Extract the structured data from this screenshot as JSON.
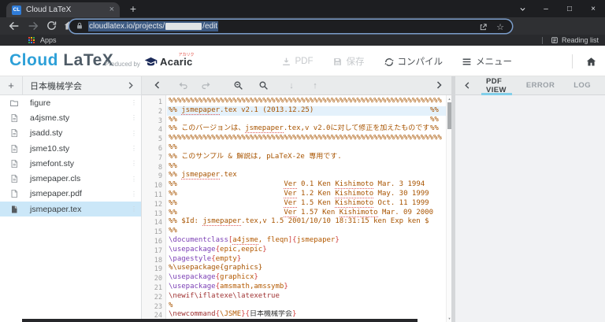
{
  "glyphs": {
    "close_tab": "×",
    "new_tab": "+",
    "overflow": "⋮",
    "star": "☆",
    "minimize": "–",
    "maximize": "□",
    "window_close": "×",
    "arrow_down": "↓",
    "arrow_up": "↑",
    "scroll_up": "▲",
    "scroll_down": "▼",
    "plus": "+"
  },
  "browser": {
    "tab_title": "Cloud LaTeX",
    "favicon_text": "CL",
    "url_prefix": "cloudlatex.io/projects/",
    "url_suffix": "/edit",
    "apps_label": "Apps",
    "reading_list_label": "Reading list"
  },
  "header": {
    "brand_cloud": "Cloud",
    "brand_latex": " LaTeX",
    "produced_by": "Produced by",
    "acaric": "Acaric",
    "acaric_kana": "アカリク",
    "actions": [
      {
        "id": "pdf",
        "label": "PDF",
        "icon": "download-icon",
        "enabled": false
      },
      {
        "id": "save",
        "label": "保存",
        "icon": "save-icon",
        "enabled": false
      },
      {
        "id": "compile",
        "label": "コンパイル",
        "icon": "compile-icon",
        "enabled": true
      },
      {
        "id": "menu",
        "label": "メニュー",
        "icon": "menu-icon",
        "enabled": true
      }
    ]
  },
  "sidebar": {
    "project_name": "日本機械学会",
    "files": [
      {
        "name": "figure",
        "icon": "folder",
        "selected": false
      },
      {
        "name": "a4jsme.sty",
        "icon": "doc",
        "selected": false
      },
      {
        "name": "jsadd.sty",
        "icon": "doc",
        "selected": false
      },
      {
        "name": "jsme10.sty",
        "icon": "doc",
        "selected": false
      },
      {
        "name": "jsmefont.sty",
        "icon": "doc",
        "selected": false
      },
      {
        "name": "jsmepaper.cls",
        "icon": "doc",
        "selected": false
      },
      {
        "name": "jsmepaper.pdf",
        "icon": "page",
        "selected": false
      },
      {
        "name": "jsmepaper.tex",
        "icon": "doc-filled",
        "selected": true
      }
    ]
  },
  "right_panel": {
    "tabs": [
      {
        "label": "PDF VIEW",
        "active": true
      },
      {
        "label": "ERROR",
        "active": false
      },
      {
        "label": "LOG",
        "active": false
      }
    ]
  },
  "editor": {
    "active_line": 2,
    "lines": [
      [
        {
          "t": "%%%%%%%%%%%%%%%%%%%%%%%%%%%%%%%%%%%%%%%%%%%%%%%%%%%%%%%%%%%%%%%%",
          "s": "com"
        }
      ],
      [
        {
          "t": "%% ",
          "s": "com"
        },
        {
          "t": "jsmepaper",
          "s": "com",
          "u": true
        },
        {
          "t": ".tex v2.1 (2013.12.25)",
          "s": "com"
        },
        {
          "t": "%%",
          "s": "com",
          "r": true
        }
      ],
      [
        {
          "t": "%%",
          "s": "com"
        },
        {
          "t": "%%",
          "s": "com",
          "r": true
        }
      ],
      [
        {
          "t": "%% このバージョンは、",
          "s": "com"
        },
        {
          "t": "jsmepaper",
          "s": "com",
          "u": true
        },
        {
          "t": ".tex,v v2.0に対して修正を加えたものです",
          "s": "com"
        },
        {
          "t": "%%",
          "s": "com",
          "r": true
        }
      ],
      [
        {
          "t": "%%%%%%%%%%%%%%%%%%%%%%%%%%%%%%%%%%%%%%%%%%%%%%%%%%%%%%%%%%%%%%%%",
          "s": "com"
        }
      ],
      [
        {
          "t": "%%",
          "s": "com"
        }
      ],
      [
        {
          "t": "%% このサンプル & 解説は, pLaTeX-2e 専用です.",
          "s": "com"
        }
      ],
      [
        {
          "t": "%%",
          "s": "com"
        }
      ],
      [
        {
          "t": "%% ",
          "s": "com"
        },
        {
          "t": "jsmepaper",
          "s": "com",
          "u": true
        },
        {
          "t": ".tex",
          "s": "com"
        }
      ],
      [
        {
          "t": "%%                         ",
          "s": "com"
        },
        {
          "t": "Ver",
          "s": "com",
          "u": true
        },
        {
          "t": " 0.1 Ken ",
          "s": "com"
        },
        {
          "t": "Kishimoto",
          "s": "com",
          "u": true
        },
        {
          "t": " Mar. 3 1994",
          "s": "com"
        }
      ],
      [
        {
          "t": "%%                         ",
          "s": "com"
        },
        {
          "t": "Ver",
          "s": "com",
          "u": true
        },
        {
          "t": " 1.2 Ken ",
          "s": "com"
        },
        {
          "t": "Kishimoto",
          "s": "com",
          "u": true
        },
        {
          "t": " May. 30 1999",
          "s": "com"
        }
      ],
      [
        {
          "t": "%%                         ",
          "s": "com"
        },
        {
          "t": "Ver",
          "s": "com",
          "u": true
        },
        {
          "t": " 1.5 Ken ",
          "s": "com"
        },
        {
          "t": "Kishimoto",
          "s": "com",
          "u": true
        },
        {
          "t": " Oct. 11 1999",
          "s": "com"
        }
      ],
      [
        {
          "t": "%%                         ",
          "s": "com"
        },
        {
          "t": "Ver",
          "s": "com",
          "u": true
        },
        {
          "t": " 1.57 Ken ",
          "s": "com"
        },
        {
          "t": "Kishimoto",
          "s": "com",
          "u": true
        },
        {
          "t": " Mar. 09 2000",
          "s": "com"
        }
      ],
      [
        {
          "t": "%% $Id: ",
          "s": "com"
        },
        {
          "t": "jsmepaper",
          "s": "com",
          "u": true
        },
        {
          "t": ".tex,v 1.5 2001/10/10 18:31:15 ken Exp ken $",
          "s": "com"
        }
      ],
      [
        {
          "t": "%%",
          "s": "com"
        }
      ],
      [
        {
          "t": "\\documentclass",
          "s": "cmd"
        },
        {
          "t": "[",
          "s": "brk"
        },
        {
          "t": "a4jsme",
          "s": "arg",
          "u": true
        },
        {
          "t": ", fleqn",
          "s": "arg"
        },
        {
          "t": "]",
          "s": "brk"
        },
        {
          "t": "{",
          "s": "brk"
        },
        {
          "t": "jsmepaper",
          "s": "arg"
        },
        {
          "t": "}",
          "s": "brk"
        }
      ],
      [
        {
          "t": "\\usepackage",
          "s": "cmd"
        },
        {
          "t": "{",
          "s": "brk"
        },
        {
          "t": "epic,eepic",
          "s": "arg"
        },
        {
          "t": "}",
          "s": "brk"
        }
      ],
      [
        {
          "t": "\\pagestyle",
          "s": "cmd"
        },
        {
          "t": "{",
          "s": "brk"
        },
        {
          "t": "empty",
          "s": "arg"
        },
        {
          "t": "}",
          "s": "brk"
        }
      ],
      [
        {
          "t": "%\\usepackage{graphics}",
          "s": "com"
        }
      ],
      [
        {
          "t": "\\usepackage",
          "s": "cmd"
        },
        {
          "t": "{",
          "s": "brk"
        },
        {
          "t": "graphicx",
          "s": "arg"
        },
        {
          "t": "}",
          "s": "brk"
        }
      ],
      [
        {
          "t": "\\usepackage",
          "s": "cmd"
        },
        {
          "t": "{",
          "s": "brk"
        },
        {
          "t": "amsmath,amssymb",
          "s": "arg"
        },
        {
          "t": "}",
          "s": "brk"
        }
      ],
      [
        {
          "t": "\\newif\\iflatexe\\latexetrue",
          "s": "cmd2"
        }
      ],
      [
        {
          "t": "%",
          "s": "com"
        }
      ],
      [
        {
          "t": "\\newcommand",
          "s": "cmd2"
        },
        {
          "t": "{",
          "s": "brk"
        },
        {
          "t": "\\JSME",
          "s": "arg"
        },
        {
          "t": "}",
          "s": "brk"
        },
        {
          "t": "{",
          "s": "brk"
        },
        {
          "t": "日本機械学会",
          "s": "plain"
        },
        {
          "t": "}",
          "s": "brk"
        }
      ]
    ]
  }
}
